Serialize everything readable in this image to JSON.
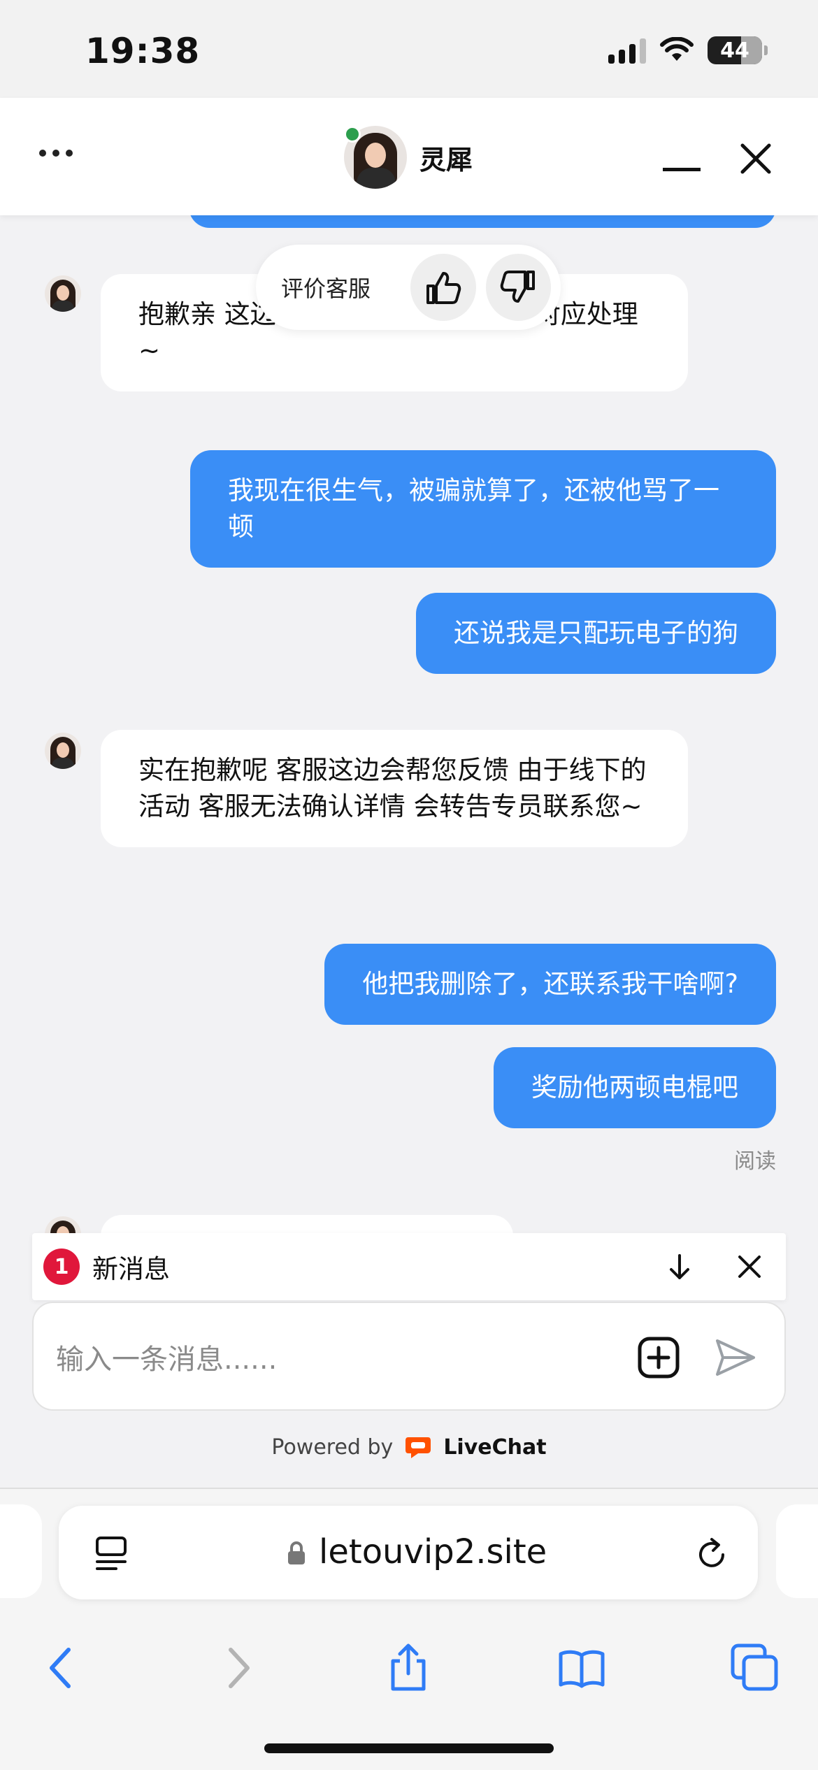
{
  "status_bar": {
    "time": "19:38",
    "battery": "44"
  },
  "header": {
    "agent_name": "灵犀"
  },
  "rating": {
    "label": "评价客服"
  },
  "messages": [
    {
      "side": "agent",
      "text": "抱歉亲 这边会帮您反馈给专员做出对应处理~"
    },
    {
      "side": "user",
      "text": "我现在很生气，被骗就算了，还被他骂了一顿"
    },
    {
      "side": "user",
      "text": "还说我是只配玩电子的狗"
    },
    {
      "side": "agent",
      "text": "实在抱歉呢 客服这边会帮您反馈 由于线下的活动 客服无法确认详情 会转告专员联系您~"
    },
    {
      "side": "user",
      "text": "他把我删除了，还联系我干啥啊?"
    },
    {
      "side": "user",
      "text": "奖励他两顿电棍吧"
    }
  ],
  "read_status": "阅读",
  "new_message": {
    "count": "1",
    "label": "新消息"
  },
  "input": {
    "placeholder": "输入一条消息......"
  },
  "powered_by": {
    "prefix": "Powered by",
    "brand": "LiveChat"
  },
  "browser": {
    "url": "letouvip2.site"
  },
  "colors": {
    "user_bubble": "#3a8ef6",
    "badge": "#e0173b",
    "ios_blue": "#2f7cf6",
    "livechat": "#ff5100",
    "online": "#2c9e4d"
  },
  "icons": [
    "ellipsis-icon",
    "minimize-icon",
    "close-icon",
    "thumbs-up-icon",
    "thumbs-down-icon",
    "arrow-down-icon",
    "add-icon",
    "send-icon",
    "page-menu-icon",
    "lock-icon",
    "reload-icon",
    "back-icon",
    "forward-icon",
    "share-icon",
    "bookmarks-icon",
    "tabs-icon"
  ]
}
